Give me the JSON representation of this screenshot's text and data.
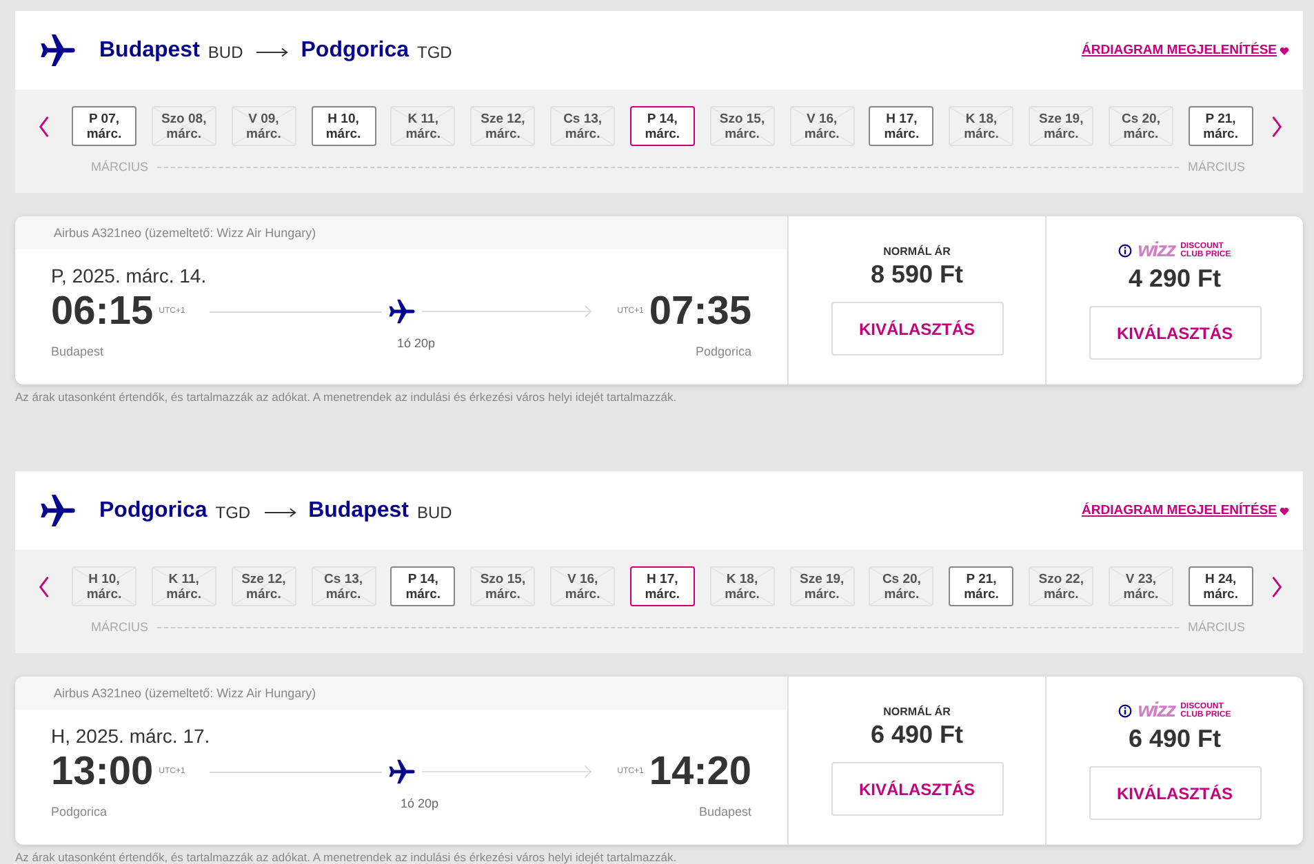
{
  "searches": [
    {
      "origin": {
        "city": "Budapest",
        "code": "BUD"
      },
      "destination": {
        "city": "Podgorica",
        "code": "TGD"
      },
      "price_chart_link": "ÁRDIAGRAM MEGJELENÍTÉSE",
      "dates": [
        {
          "label": "P 07,\nmárc.",
          "available": true,
          "selected": false
        },
        {
          "label": "Szo 08,\nmárc.",
          "available": false,
          "selected": false
        },
        {
          "label": "V 09,\nmárc.",
          "available": false,
          "selected": false
        },
        {
          "label": "H 10,\nmárc.",
          "available": true,
          "selected": false
        },
        {
          "label": "K 11,\nmárc.",
          "available": false,
          "selected": false
        },
        {
          "label": "Sze 12,\nmárc.",
          "available": false,
          "selected": false
        },
        {
          "label": "Cs 13,\nmárc.",
          "available": false,
          "selected": false
        },
        {
          "label": "P 14,\nmárc.",
          "available": true,
          "selected": true
        },
        {
          "label": "Szo 15,\nmárc.",
          "available": false,
          "selected": false
        },
        {
          "label": "V 16,\nmárc.",
          "available": false,
          "selected": false
        },
        {
          "label": "H 17,\nmárc.",
          "available": true,
          "selected": false
        },
        {
          "label": "K 18,\nmárc.",
          "available": false,
          "selected": false
        },
        {
          "label": "Sze 19,\nmárc.",
          "available": false,
          "selected": false
        },
        {
          "label": "Cs 20,\nmárc.",
          "available": false,
          "selected": false
        },
        {
          "label": "P 21,\nmárc.",
          "available": true,
          "selected": false
        }
      ],
      "month_labels": [
        "MÁRCIUS",
        "MÁRCIUS"
      ],
      "flight": {
        "aircraft": "Airbus A321neo (üzemeltető: Wizz Air Hungary)",
        "date": "P, 2025. márc. 14.",
        "departure": {
          "time": "06:15",
          "utc": "UTC+1",
          "city": "Budapest"
        },
        "arrival": {
          "time": "07:35",
          "utc": "UTC+1",
          "city": "Podgorica"
        },
        "duration": "1ó 20p",
        "fares": [
          {
            "kind": "normal",
            "label": "NORMÁL ÁR",
            "price": "8 590 Ft",
            "button": "KIVÁLASZTÁS"
          },
          {
            "kind": "club",
            "brand": "wizz",
            "badge": "DISCOUNT\nCLUB PRICE",
            "price": "4 290 Ft",
            "button": "KIVÁLASZTÁS"
          }
        ]
      },
      "note": "Az árak utasonként értendők, és tartalmazzák az adókat. A menetrendek az indulási és érkezési város helyi idejét tartalmazzák."
    },
    {
      "origin": {
        "city": "Podgorica",
        "code": "TGD"
      },
      "destination": {
        "city": "Budapest",
        "code": "BUD"
      },
      "price_chart_link": "ÁRDIAGRAM MEGJELENÍTÉSE",
      "dates": [
        {
          "label": "H 10,\nmárc.",
          "available": false,
          "selected": false
        },
        {
          "label": "K 11,\nmárc.",
          "available": false,
          "selected": false
        },
        {
          "label": "Sze 12,\nmárc.",
          "available": false,
          "selected": false
        },
        {
          "label": "Cs 13,\nmárc.",
          "available": false,
          "selected": false
        },
        {
          "label": "P 14,\nmárc.",
          "available": true,
          "selected": false
        },
        {
          "label": "Szo 15,\nmárc.",
          "available": false,
          "selected": false
        },
        {
          "label": "V 16,\nmárc.",
          "available": false,
          "selected": false
        },
        {
          "label": "H 17,\nmárc.",
          "available": true,
          "selected": true
        },
        {
          "label": "K 18,\nmárc.",
          "available": false,
          "selected": false
        },
        {
          "label": "Sze 19,\nmárc.",
          "available": false,
          "selected": false
        },
        {
          "label": "Cs 20,\nmárc.",
          "available": false,
          "selected": false
        },
        {
          "label": "P 21,\nmárc.",
          "available": true,
          "selected": false
        },
        {
          "label": "Szo 22,\nmárc.",
          "available": false,
          "selected": false
        },
        {
          "label": "V 23,\nmárc.",
          "available": false,
          "selected": false
        },
        {
          "label": "H 24,\nmárc.",
          "available": true,
          "selected": false
        }
      ],
      "month_labels": [
        "MÁRCIUS",
        "MÁRCIUS"
      ],
      "flight": {
        "aircraft": "Airbus A321neo (üzemeltető: Wizz Air Hungary)",
        "date": "H, 2025. márc. 17.",
        "departure": {
          "time": "13:00",
          "utc": "UTC+1",
          "city": "Podgorica"
        },
        "arrival": {
          "time": "14:20",
          "utc": "UTC+1",
          "city": "Budapest"
        },
        "duration": "1ó 20p",
        "fares": [
          {
            "kind": "normal",
            "label": "NORMÁL ÁR",
            "price": "6 490 Ft",
            "button": "KIVÁLASZTÁS"
          },
          {
            "kind": "club",
            "brand": "wizz",
            "badge": "DISCOUNT\nCLUB PRICE",
            "price": "6 490 Ft",
            "button": "KIVÁLASZTÁS"
          }
        ]
      },
      "note": "Az árak utasonként értendők, és tartalmazzák az adókat. A menetrendek az indulási és érkezési város helyi idejét tartalmazzák."
    }
  ]
}
